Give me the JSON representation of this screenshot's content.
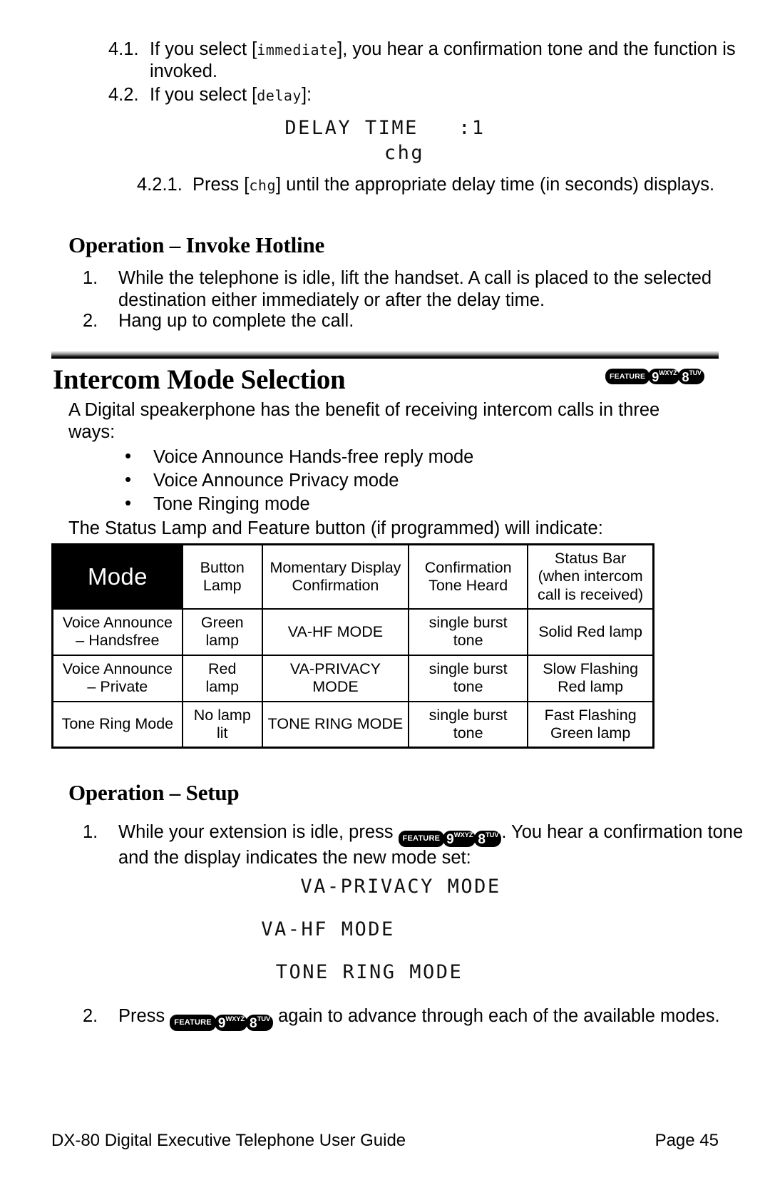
{
  "steps_top": [
    {
      "number": "4.1.",
      "text_before": "If you select [",
      "lcd_token": "immediate",
      "text_after": "], you hear a confirmation tone and the function is invoked."
    },
    {
      "number": "4.2.",
      "text_before": "If you select [",
      "lcd_token": "delay",
      "text_after": "]:"
    }
  ],
  "display_delay": {
    "line1": "DELAY TIME   :1",
    "line2": "chg"
  },
  "step_421": {
    "number": "4.2.1.",
    "text_before": "Press [",
    "lcd_token": "chg",
    "text_after": "] until the appropriate delay time (in seconds) displays."
  },
  "invoke_hotline": {
    "heading": "Operation – Invoke Hotline",
    "steps": [
      {
        "number": "1.",
        "text": "While the telephone is idle, lift the handset. A call is placed to the selected destination either immediately or after the delay time."
      },
      {
        "number": "2.",
        "text": "Hang up to complete the call."
      }
    ]
  },
  "intercom": {
    "title": "Intercom Mode Selection",
    "intro": "A Digital speakerphone has the benefit of receiving intercom calls in three ways:",
    "modes": [
      "Voice Announce Hands-free reply mode",
      "Voice Announce Privacy mode",
      "Tone Ringing mode"
    ],
    "table_lead": "The Status Lamp and Feature button (if programmed) will indicate:"
  },
  "keys": {
    "feature_label": "FEATURE",
    "key9": {
      "digit": "9",
      "letters": "WXYZ"
    },
    "key8": {
      "digit": "8",
      "letters": "TUV"
    }
  },
  "table": {
    "headers": [
      "Mode",
      "Button Lamp",
      "Momentary Display Confirmation",
      "Confirmation Tone Heard",
      "Status Bar (when intercom call is received)"
    ],
    "headers_lines": {
      "mode": "Mode",
      "lamp": [
        "Button",
        "Lamp"
      ],
      "display": [
        "Momentary Display",
        "Confirmation"
      ],
      "tone": [
        "Confirmation",
        "Tone Heard"
      ],
      "bar": [
        "Status Bar",
        "(when intercom",
        "call is received)"
      ]
    },
    "rows": [
      {
        "mode": [
          "Voice Announce",
          "– Handsfree"
        ],
        "lamp": [
          "Green",
          "lamp"
        ],
        "display": [
          "VA-HF MODE"
        ],
        "tone": [
          "single burst",
          "tone"
        ],
        "bar": [
          "Solid Red lamp"
        ]
      },
      {
        "mode": [
          "Voice Announce",
          "– Private"
        ],
        "lamp": [
          "Red",
          "lamp"
        ],
        "display": [
          "VA-PRIVACY",
          "MODE"
        ],
        "tone": [
          "single burst",
          "tone"
        ],
        "bar": [
          "Slow Flashing",
          "Red lamp"
        ]
      },
      {
        "mode": [
          "Tone Ring Mode"
        ],
        "lamp": [
          "No lamp",
          "lit"
        ],
        "display": [
          "TONE RING MODE"
        ],
        "tone": [
          "single burst",
          "tone"
        ],
        "bar": [
          "Fast Flashing",
          "Green lamp"
        ]
      }
    ]
  },
  "setup": {
    "heading": "Operation – Setup",
    "step1": {
      "number": "1.",
      "text_before": "While your extension is idle, press ",
      "text_after": ". You hear a confirmation tone and the display indicates the new mode set:"
    },
    "displays": [
      "VA-PRIVACY MODE",
      "VA-HF MODE",
      "TONE RING MODE"
    ],
    "step2": {
      "number": "2.",
      "text_before": "Press ",
      "text_after": " again to advance through each of the available modes."
    }
  },
  "footer": {
    "left": "DX-80 Digital Executive Telephone User Guide",
    "right": "Page 45"
  }
}
